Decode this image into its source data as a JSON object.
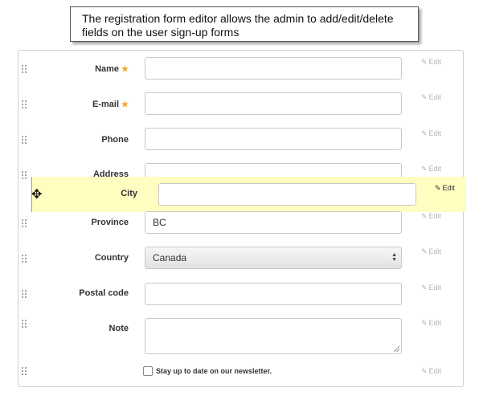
{
  "callout": {
    "text": "The registration form editor allows the admin to add/edit/delete fields on the user sign-up forms"
  },
  "edit_label": "Edit",
  "required_mark": "★",
  "fields": {
    "name": {
      "label": "Name",
      "required": true,
      "value": ""
    },
    "email": {
      "label": "E-mail",
      "required": true,
      "value": ""
    },
    "phone": {
      "label": "Phone",
      "value": ""
    },
    "address": {
      "label": "Address",
      "value": ""
    },
    "city": {
      "label": "City",
      "value": ""
    },
    "province": {
      "label": "Province",
      "value": "BC"
    },
    "country": {
      "label": "Country",
      "value": "Canada"
    },
    "postal_code": {
      "label": "Postal code",
      "value": ""
    },
    "note": {
      "label": "Note",
      "value": ""
    }
  },
  "newsletter": {
    "label": "Stay up to date on our newsletter.",
    "checked": false
  },
  "icons": {
    "drag": "drag-handle-icon",
    "move": "move-cursor-icon",
    "pencil": "pencil-icon"
  },
  "colors": {
    "drag_highlight": "#fffdc0",
    "required_star": "#f0a020"
  }
}
